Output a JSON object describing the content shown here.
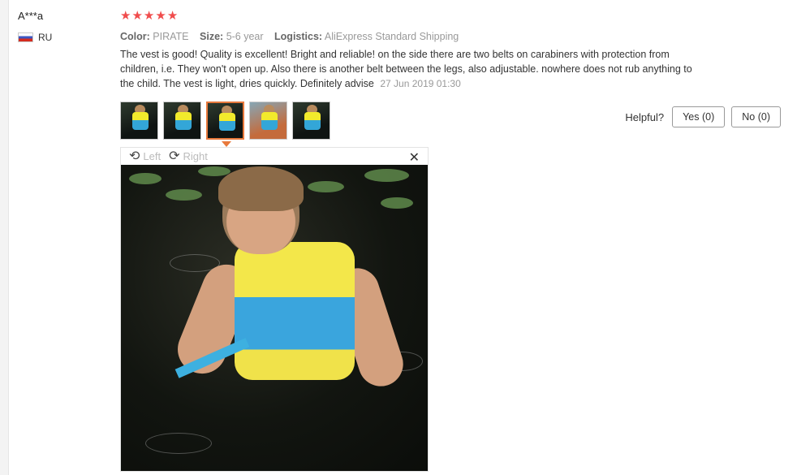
{
  "reviewer": {
    "name": "A***a",
    "country": "RU"
  },
  "rating": {
    "stars": 5
  },
  "meta": {
    "color_label": "Color:",
    "color_value": "PIRATE",
    "size_label": "Size:",
    "size_value": "5-6 year",
    "logistics_label": "Logistics:",
    "logistics_value": "AliExpress Standard Shipping"
  },
  "review": {
    "text": "The vest is good! Quality is excellent! Bright and reliable! on the side there are two belts on carabiners with protection from children, i.e. They won't open up. Also there is another belt between the legs, also adjustable. nowhere does not rub anything to the child. The vest is light, dries quickly. Definitely advise",
    "date": "27 Jun 2019 01:30"
  },
  "thumbnails": {
    "count": 5,
    "selected_index": 3
  },
  "viewer": {
    "left_label": "Left",
    "right_label": "Right"
  },
  "helpful": {
    "label": "Helpful?",
    "yes_label": "Yes (0)",
    "no_label": "No (0)"
  },
  "colors": {
    "star": "#f04c4c",
    "accent": "#e8793c"
  },
  "icons": [
    "star-icon",
    "flag-icon",
    "rotate-left-icon",
    "rotate-right-icon",
    "close-icon"
  ]
}
